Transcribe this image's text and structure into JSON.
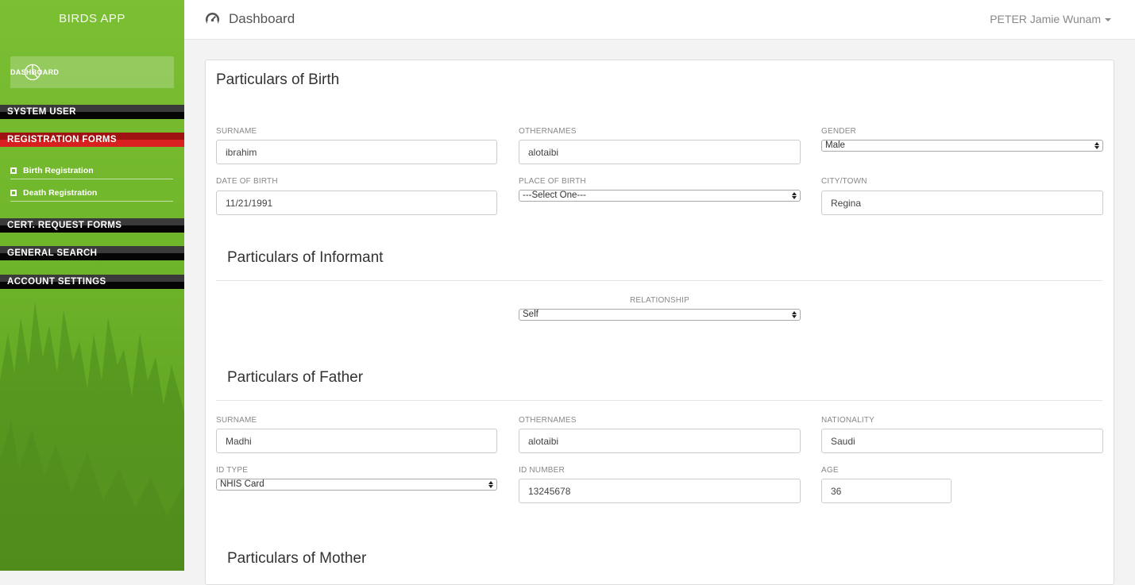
{
  "sidebar": {
    "brand": "BIRDS APP",
    "dashboard_label": "DASHBOARD",
    "sections": {
      "system_user": "SYSTEM USER",
      "registration_forms": "REGISTRATION FORMS",
      "cert_request_forms": "CERT. REQUEST FORMS",
      "general_search": "GENERAL SEARCH",
      "account_settings": "ACCOUNT SETTINGS"
    },
    "sub_items": {
      "birth_registration": "Birth Registration",
      "death_registration": "Death Registration"
    }
  },
  "header": {
    "title": "Dashboard",
    "user_name": "PETER Jamie Wunam"
  },
  "birth": {
    "heading": "Particulars of Birth",
    "surname_label": "SURNAME",
    "surname": "ibrahim",
    "othernames_label": "OTHERNAMES",
    "othernames": "alotaibi",
    "gender_label": "GENDER",
    "gender": "Male",
    "dob_label": "DATE OF BIRTH",
    "dob": "11/21/1991",
    "place_label": "PLACE OF BIRTH",
    "place": "---Select One---",
    "city_label": "CITY/TOWN",
    "city": "Regina"
  },
  "informant": {
    "heading": "Particulars of Informant",
    "relationship_label": "RELATIONSHIP",
    "relationship": "Self"
  },
  "father": {
    "heading": "Particulars of Father",
    "surname_label": "SURNAME",
    "surname": "Madhi",
    "othernames_label": "OTHERNAMES",
    "othernames": "alotaibi",
    "nationality_label": "NATIONALITY",
    "nationality": "Saudi",
    "id_type_label": "ID TYPE",
    "id_type": "NHIS Card",
    "id_number_label": "ID NUMBER",
    "id_number": "13245678",
    "age_label": "AGE",
    "age": "36"
  },
  "mother": {
    "heading": "Particulars of Mother"
  },
  "colors": {
    "sidebar_green": "#6fb52a",
    "section_red": "#d92020",
    "section_black": "#050505"
  },
  "icons": {
    "dashboard": "pie-chart-icon",
    "header": "gauge-icon",
    "sub_item": "square-icon"
  }
}
